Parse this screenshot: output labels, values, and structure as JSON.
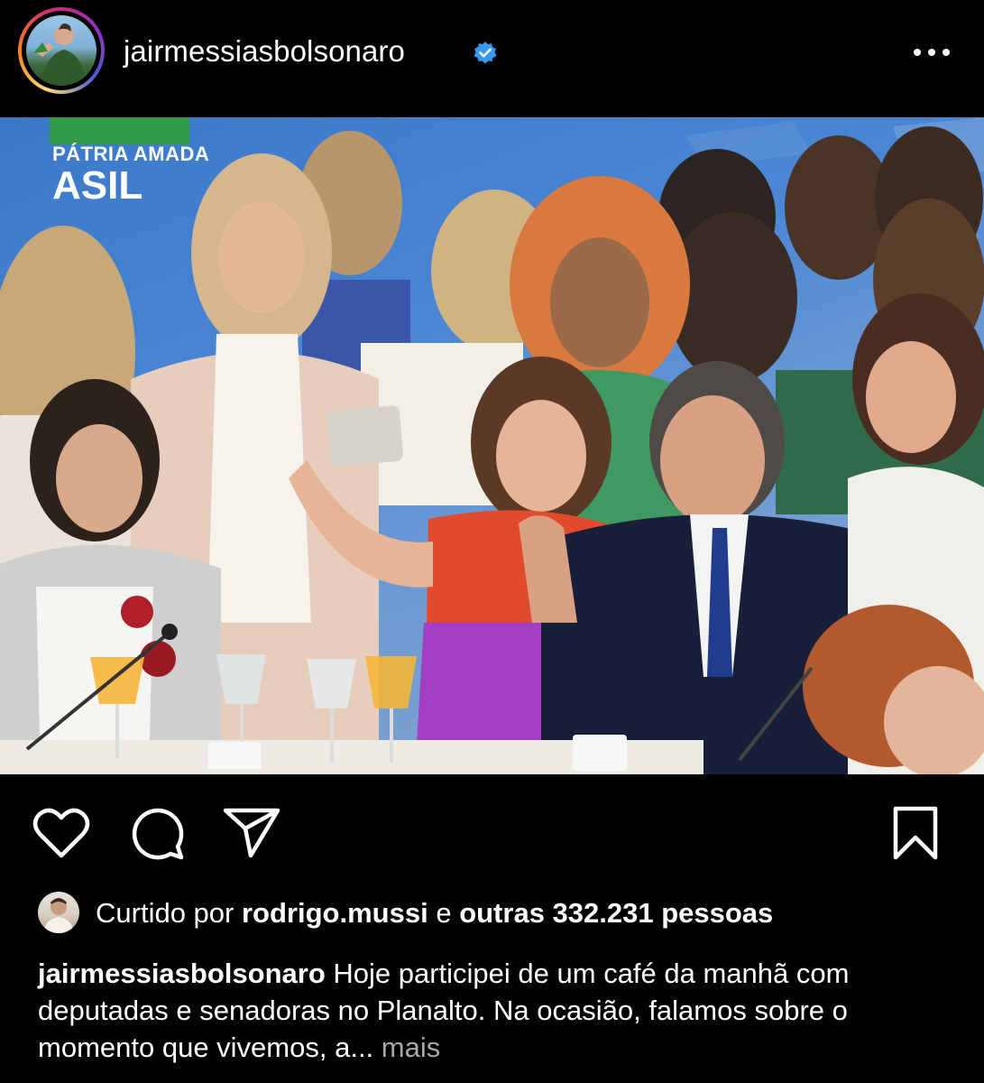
{
  "post": {
    "username": "jairmessiasbolsonaro",
    "verified": true,
    "verified_color": "#3897f0"
  },
  "photo": {
    "banner_line1": "PÁTRIA AMADA",
    "banner_line2": "ASIL"
  },
  "actions": {
    "like_icon": "heart-icon",
    "comment_icon": "comment-icon",
    "share_icon": "send-icon",
    "save_icon": "bookmark-icon"
  },
  "likes": {
    "prefix": "Curtido por",
    "liker": "rodrigo.mussi",
    "connector": "e",
    "others": "outras 332.231 pessoas"
  },
  "caption": {
    "author": "jairmessiasbolsonaro",
    "text": "Hoje participei de um café da manhã com deputadas e senadoras no Planalto. Na ocasião, falamos sobre o momento que vivemos, a...",
    "more_label": "mais"
  }
}
